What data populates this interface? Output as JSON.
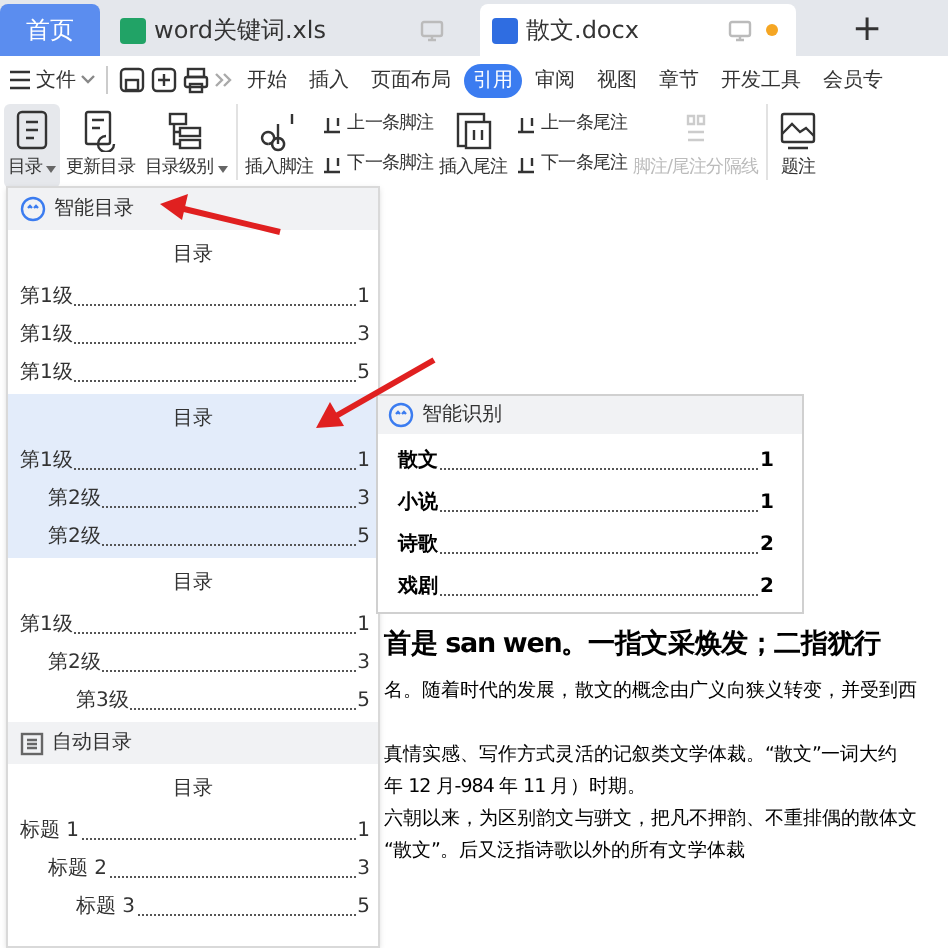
{
  "tabs": [
    {
      "label": "首页",
      "kind": "home",
      "selected": false,
      "unsaved": false
    },
    {
      "label": "word关键词.xls",
      "kind": "sheet",
      "selected": false,
      "unsaved": false
    },
    {
      "label": "散文.docx",
      "kind": "doc",
      "selected": true,
      "unsaved": true
    }
  ],
  "new_tab": "+",
  "menu": {
    "file_label": "文件",
    "items": [
      {
        "label": "开始",
        "selected": false
      },
      {
        "label": "插入",
        "selected": false
      },
      {
        "label": "页面布局",
        "selected": false
      },
      {
        "label": "引用",
        "selected": true
      },
      {
        "label": "审阅",
        "selected": false
      },
      {
        "label": "视图",
        "selected": false
      },
      {
        "label": "章节",
        "selected": false
      },
      {
        "label": "开发工具",
        "selected": false
      },
      {
        "label": "会员专",
        "selected": false
      }
    ]
  },
  "ribbon": [
    {
      "kind": "large",
      "label": "目录",
      "dropdown": true,
      "selected": true,
      "disabled": false
    },
    {
      "kind": "large",
      "label": "更新目录",
      "dropdown": false,
      "selected": false,
      "disabled": false
    },
    {
      "kind": "large",
      "label": "目录级别",
      "dropdown": true,
      "selected": false,
      "disabled": false
    },
    {
      "kind": "large",
      "label": "插入脚注",
      "dropdown": false,
      "selected": false,
      "disabled": false
    },
    {
      "kind": "pair",
      "labels": [
        "上一条脚注",
        "下一条脚注"
      ]
    },
    {
      "kind": "large",
      "label": "插入尾注",
      "dropdown": false,
      "selected": false,
      "disabled": false
    },
    {
      "kind": "pair",
      "labels": [
        "上一条尾注",
        "下一条尾注"
      ]
    },
    {
      "kind": "large",
      "label": "脚注/尾注分隔线",
      "dropdown": false,
      "selected": false,
      "disabled": true
    },
    {
      "kind": "large",
      "label": "题注",
      "dropdown": false,
      "selected": false,
      "disabled": false
    }
  ],
  "toc_panel": {
    "sections": [
      {
        "title": "智能目录",
        "kind": "smart",
        "presets": [
          {
            "heading": "目录",
            "selected": false,
            "entries": [
              {
                "label": "第1级",
                "page": "1"
              },
              {
                "label": "第1级",
                "page": "3"
              },
              {
                "label": "第1级",
                "page": "5"
              }
            ]
          },
          {
            "heading": "目录",
            "selected": true,
            "entries": [
              {
                "label": "第1级",
                "page": "1",
                "children": [
                  {
                    "label": "第2级",
                    "page": "3"
                  },
                  {
                    "label": "第2级",
                    "page": "5"
                  }
                ]
              }
            ]
          },
          {
            "heading": "目录",
            "selected": false,
            "entries": [
              {
                "label": "第1级",
                "page": "1",
                "children": [
                  {
                    "label": "第2级",
                    "page": "3",
                    "children": [
                      {
                        "label": "第3级",
                        "page": "5"
                      }
                    ]
                  }
                ]
              }
            ]
          }
        ]
      },
      {
        "title": "自动目录",
        "kind": "auto",
        "presets": [
          {
            "heading": "目录",
            "selected": false,
            "entries": [
              {
                "label": "标题 1",
                "page": "1",
                "children": [
                  {
                    "label": "标题 2",
                    "page": "3",
                    "children": [
                      {
                        "label": "标题 3",
                        "page": "5"
                      }
                    ]
                  }
                ]
              }
            ]
          }
        ]
      }
    ]
  },
  "smart_recognition": {
    "title": "智能识别",
    "entries": [
      {
        "label": "散文",
        "page": "1"
      },
      {
        "label": "小说",
        "page": "1"
      },
      {
        "label": "诗歌",
        "page": "2"
      },
      {
        "label": "戏剧",
        "page": "2"
      }
    ]
  },
  "document": {
    "lines": [
      {
        "kind": "heading",
        "text": "首是 san wen。一指文采焕发；二指犹行"
      },
      {
        "kind": "body",
        "text": "名。随着时代的发展，散文的概念由广义向狭义转变，并受到西"
      },
      {
        "kind": "paragraph",
        "text": "真情实感、写作方式灵活的记叙类文学体裁。“散文”一词大约"
      },
      {
        "kind": "body",
        "text": "年 12 月-984 年 11 月）时期。"
      },
      {
        "kind": "body",
        "text": "六朝以来，为区别韵文与骈文，把凡不押韵、不重排偶的散体文"
      },
      {
        "kind": "body",
        "text": "“散文”。后又泛指诗歌以外的所有文学体裁"
      }
    ]
  }
}
